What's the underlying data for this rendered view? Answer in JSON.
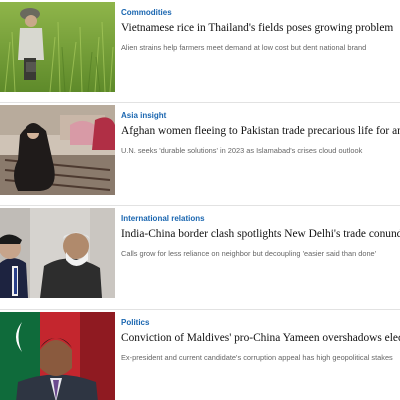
{
  "articles": [
    {
      "category": "Commodities",
      "headline": "Vietnamese rice in Thailand's fields poses growing problem",
      "summary": "Alien strains help farmers meet demand at low cost but dent national brand"
    },
    {
      "category": "Asia insight",
      "headline": "Afghan women fleeing to Pakistan trade precarious life for another",
      "summary": "U.N. seeks 'durable solutions' in 2023 as Islamabad's crises cloud outlook"
    },
    {
      "category": "International relations",
      "headline": "India-China border clash spotlights New Delhi's trade conundrum",
      "summary": "Calls grow for less reliance on neighbor but decoupling 'easier said than done'"
    },
    {
      "category": "Politics",
      "headline": "Conviction of Maldives' pro-China Yameen overshadows election",
      "summary": "Ex-president and current candidate's corruption appeal has high geopolitical stakes"
    }
  ],
  "colors": {
    "category": "#1a66b0",
    "divider": "#e2e2e2"
  }
}
